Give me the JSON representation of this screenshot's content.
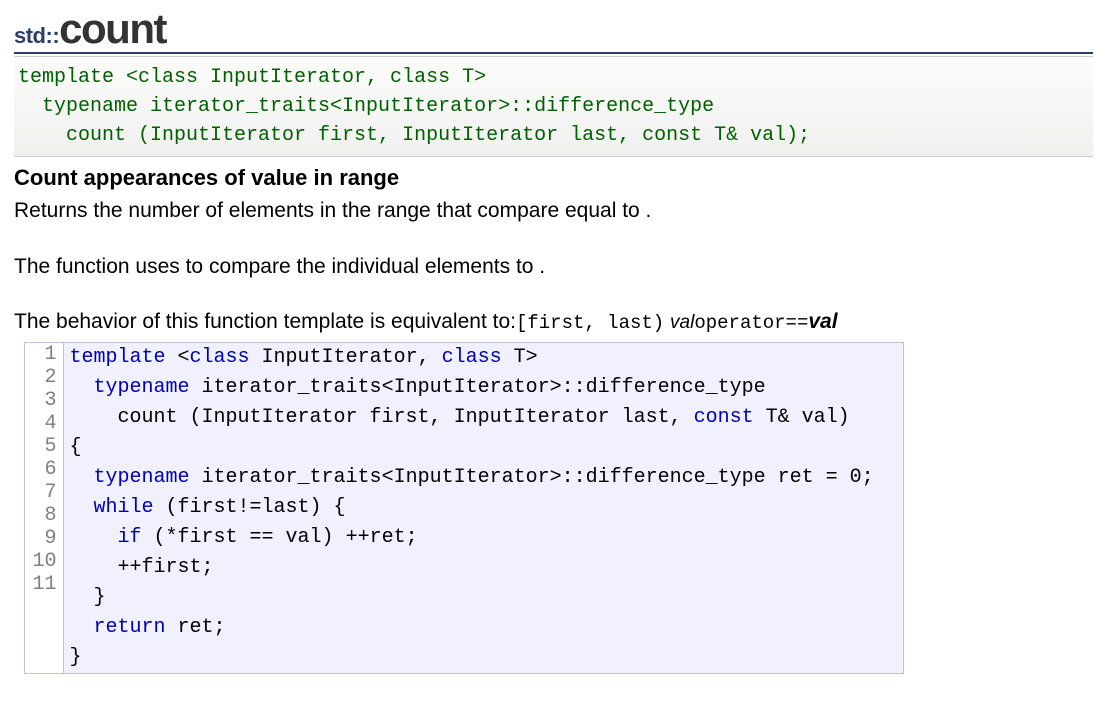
{
  "title": {
    "namespace": "std::",
    "function": "count"
  },
  "signature": "template <class InputIterator, class T>\n  typename iterator_traits<InputIterator>::difference_type\n    count (InputIterator first, InputIterator last, const T& val);",
  "section_heading": "Count appearances of value in range",
  "paragraphs": {
    "p1": "Returns the number of elements in the range that compare equal to .",
    "p2": "The function uses to compare the individual elements to .",
    "p3": "The behavior of this function template is equivalent to:",
    "frag_range": "[first, last)",
    "frag_val1": "val",
    "frag_op": "operator==",
    "frag_val2": "val"
  },
  "source_lines": [
    "1",
    "2",
    "3",
    "4",
    "5",
    "6",
    "7",
    "8",
    "9",
    "10",
    "11"
  ],
  "src": {
    "l1": {
      "a": "template",
      "b": " <",
      "c": "class",
      "d": " InputIterator, ",
      "e": "class",
      "f": " T>"
    },
    "l2": {
      "a": "  ",
      "b": "typename",
      "c": " iterator_traits<InputIterator>::difference_type"
    },
    "l3": "    count (InputIterator first, InputIterator last, ",
    "l3b": "const",
    "l3c": " T& val)",
    "l4": "{",
    "l5": {
      "a": "  ",
      "b": "typename",
      "c": " iterator_traits<InputIterator>::difference_type ret = 0;"
    },
    "l6": {
      "a": "  ",
      "b": "while",
      "c": " (first!=last) {"
    },
    "l7": {
      "a": "    ",
      "b": "if",
      "c": " (*first == val) ++ret;"
    },
    "l8": "    ++first;",
    "l9": "  }",
    "l10": {
      "a": "  ",
      "b": "return",
      "c": " ret;"
    },
    "l11": "}"
  }
}
